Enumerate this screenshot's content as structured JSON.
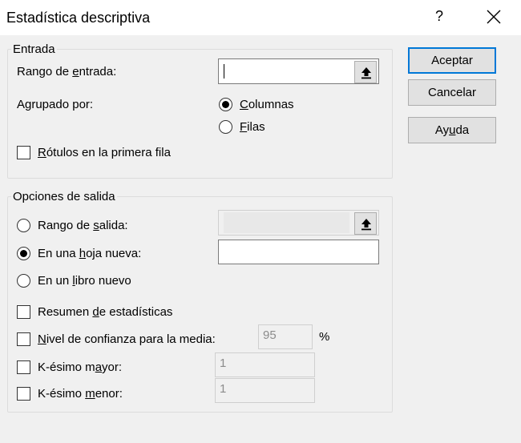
{
  "window": {
    "title": "Estadística descriptiva",
    "help_label": "?",
    "close_icon": "close-icon"
  },
  "buttons": {
    "accept": "Aceptar",
    "cancel": "Cancelar",
    "help": {
      "before": "Ay",
      "key": "u",
      "after": "da"
    }
  },
  "input_group": {
    "legend": "Entrada",
    "range_label": {
      "before": "Rango de ",
      "key": "e",
      "after": "ntrada:"
    },
    "range_value": "",
    "grouped_by_label": "Agrupado por:",
    "columns": {
      "key": "C",
      "after": "olumnas",
      "checked": true
    },
    "rows": {
      "key": "F",
      "after": "ilas",
      "checked": false
    },
    "labels_first_row": {
      "key": "R",
      "after": "ótulos en la primera fila",
      "checked": false
    }
  },
  "output_group": {
    "legend": "Opciones de salida",
    "output_range": {
      "before": "Rango de ",
      "key": "s",
      "after": "alida:",
      "checked": false
    },
    "new_sheet": {
      "before": "En una ",
      "key": "h",
      "after": "oja nueva:",
      "checked": true
    },
    "new_sheet_value": "",
    "new_workbook": {
      "before": "En un ",
      "key": "l",
      "after": "ibro nuevo",
      "checked": false
    },
    "summary_stats": {
      "before": "Resumen ",
      "key": "d",
      "after": "e estadísticas",
      "checked": false
    },
    "confidence": {
      "key": "N",
      "after": "ivel de confianza para la media:",
      "checked": false,
      "value": "95",
      "unit": "%"
    },
    "kth_largest": {
      "before": "K-ésimo m",
      "key": "a",
      "after": "yor:",
      "checked": false,
      "value": "1"
    },
    "kth_smallest": {
      "before": "K-ésimo ",
      "key": "m",
      "after": "enor:",
      "checked": false,
      "value": "1"
    }
  },
  "icons": {
    "ref_button": "collapse-dialog-arrow-icon"
  }
}
